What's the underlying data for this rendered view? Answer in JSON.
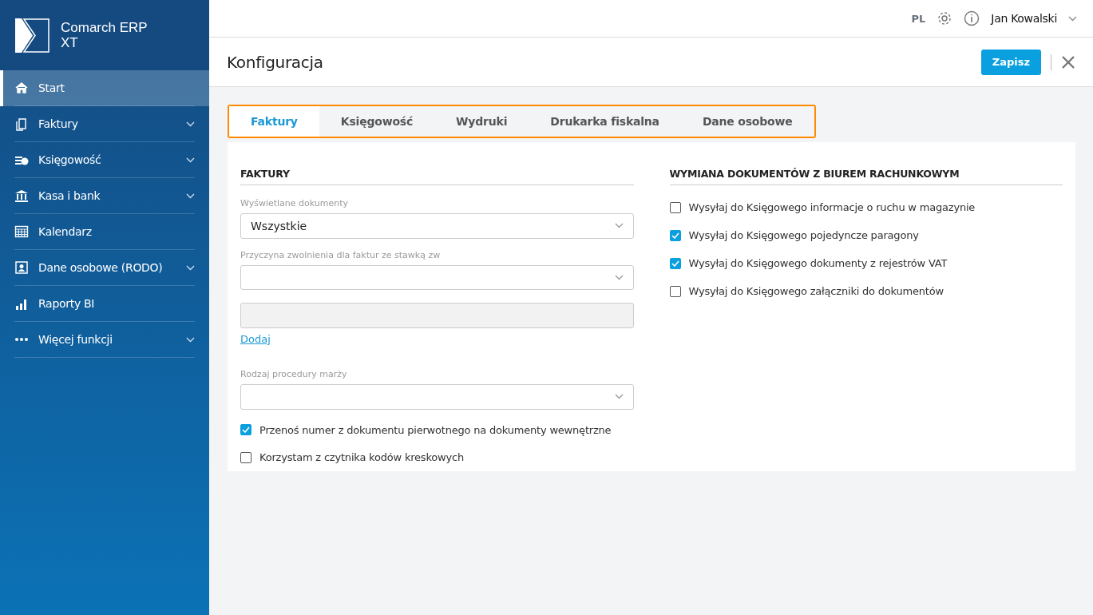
{
  "app": {
    "name_line1": "Comarch ERP",
    "name_line2": "XT"
  },
  "sidebar": {
    "items": [
      {
        "label": "Start",
        "selected": true,
        "expandable": false
      },
      {
        "label": "Faktury",
        "selected": false,
        "expandable": true
      },
      {
        "label": "Księgowość",
        "selected": false,
        "expandable": true
      },
      {
        "label": "Kasa i bank",
        "selected": false,
        "expandable": true
      },
      {
        "label": "Kalendarz",
        "selected": false,
        "expandable": false
      },
      {
        "label": "Dane osobowe (RODO)",
        "selected": false,
        "expandable": true
      },
      {
        "label": "Raporty BI",
        "selected": false,
        "expandable": false
      },
      {
        "label": "Więcej funkcji",
        "selected": false,
        "expandable": true
      }
    ]
  },
  "topbar": {
    "language": "PL",
    "user": "Jan Kowalski"
  },
  "page": {
    "title": "Konfiguracja",
    "save_button": "Zapisz"
  },
  "tabs": [
    {
      "label": "Faktury",
      "selected": true
    },
    {
      "label": "Księgowość",
      "selected": false
    },
    {
      "label": "Wydruki",
      "selected": false
    },
    {
      "label": "Drukarka fiskalna",
      "selected": false
    },
    {
      "label": "Dane osobowe",
      "selected": false
    }
  ],
  "left_section": {
    "title": "FAKTURY",
    "fields": [
      {
        "kind": "select",
        "label": "Wyświetlane dokumenty",
        "value": "Wszystkie"
      },
      {
        "kind": "select",
        "label": "Przyczyna zwolnienia dla faktur ze stawką zw"
      },
      {
        "kind": "disabled"
      },
      {
        "kind": "link",
        "label": "Dodaj"
      },
      {
        "kind": "select",
        "label": "Rodzaj procedury marży"
      },
      {
        "kind": "checkbox",
        "label": "Przenoś numer z dokumentu pierwotnego na dokumenty wewnętrzne",
        "checked": true
      },
      {
        "kind": "checkbox",
        "label": "Korzystam z czytnika kodów kreskowych",
        "checked": false
      }
    ]
  },
  "right_section": {
    "title": "WYMIANA DOKUMENTÓW Z BIUREM RACHUNKOWYM",
    "fields": [
      {
        "kind": "checkbox",
        "label": "Wysyłaj do Księgowego informacje o ruchu w magazynie",
        "checked": false
      },
      {
        "kind": "checkbox",
        "label": "Wysyłaj do Księgowego pojedyncze paragony",
        "checked": true
      },
      {
        "kind": "checkbox",
        "label": "Wysyłaj do Księgowego dokumenty z rejestrów VAT",
        "checked": true
      },
      {
        "kind": "checkbox",
        "label": "Wysyłaj do Księgowego załączniki do dokumentów",
        "checked": false
      }
    ]
  }
}
